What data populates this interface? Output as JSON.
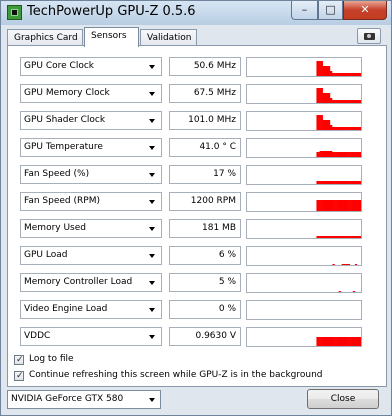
{
  "window": {
    "title": "TechPowerUp GPU-Z 0.5.6",
    "minimize_glyph": "–",
    "maximize_glyph": "□",
    "close_glyph": "✕"
  },
  "tabs": [
    {
      "label": "Graphics Card",
      "active": false
    },
    {
      "label": "Sensors",
      "active": true
    },
    {
      "label": "Validation",
      "active": false
    }
  ],
  "icons": {
    "screenshot": "camera-icon",
    "dropdown": "chevron-down-icon",
    "app": "gpu-z-icon"
  },
  "sensors": [
    {
      "label": "GPU Core Clock",
      "value": "50.6 MHz",
      "history": [
        0,
        0,
        0,
        0,
        0,
        0,
        0,
        0,
        0,
        0,
        0,
        0,
        0,
        0,
        0,
        0,
        0,
        0,
        0,
        0,
        0,
        0,
        0,
        0,
        0,
        0,
        0,
        0,
        0,
        0,
        0,
        0,
        0,
        0,
        0,
        0,
        0,
        0,
        0,
        0,
        0,
        0,
        0,
        0,
        0,
        0,
        0,
        0,
        0,
        0,
        0,
        0,
        0,
        0,
        0,
        0,
        0,
        0,
        0,
        0,
        0,
        0,
        0,
        0,
        0,
        0,
        0,
        0.85,
        0.85,
        0.85,
        0.85,
        0.85,
        0.85,
        0.55,
        0.55,
        0.55,
        0.55,
        0.55,
        0.55,
        0.55,
        0.25,
        0.25,
        0.15,
        0.15,
        0.15,
        0.15,
        0.15,
        0.15,
        0.15,
        0.15,
        0.15,
        0.15,
        0.15,
        0.15,
        0.15,
        0.15,
        0.15,
        0.15,
        0.15,
        0.15,
        0.15,
        0.15,
        0.15,
        0.15,
        0.15,
        0.15,
        0.15,
        0.15,
        0.15,
        0.15
      ]
    },
    {
      "label": "GPU Memory Clock",
      "value": "67.5 MHz",
      "history": [
        0,
        0,
        0,
        0,
        0,
        0,
        0,
        0,
        0,
        0,
        0,
        0,
        0,
        0,
        0,
        0,
        0,
        0,
        0,
        0,
        0,
        0,
        0,
        0,
        0,
        0,
        0,
        0,
        0,
        0,
        0,
        0,
        0,
        0,
        0,
        0,
        0,
        0,
        0,
        0,
        0,
        0,
        0,
        0,
        0,
        0,
        0,
        0,
        0,
        0,
        0,
        0,
        0,
        0,
        0,
        0,
        0,
        0,
        0,
        0,
        0,
        0,
        0,
        0,
        0,
        0,
        0,
        0.85,
        0.85,
        0.85,
        0.85,
        0.85,
        0.85,
        0.55,
        0.55,
        0.55,
        0.55,
        0.55,
        0.55,
        0.55,
        0.25,
        0.25,
        0.15,
        0.15,
        0.15,
        0.15,
        0.15,
        0.15,
        0.15,
        0.15,
        0.15,
        0.15,
        0.15,
        0.15,
        0.15,
        0.15,
        0.15,
        0.15,
        0.15,
        0.15,
        0.15,
        0.15,
        0.15,
        0.15,
        0.15,
        0.15,
        0.15,
        0.15,
        0.15,
        0.15
      ]
    },
    {
      "label": "GPU Shader Clock",
      "value": "101.0 MHz",
      "history": [
        0,
        0,
        0,
        0,
        0,
        0,
        0,
        0,
        0,
        0,
        0,
        0,
        0,
        0,
        0,
        0,
        0,
        0,
        0,
        0,
        0,
        0,
        0,
        0,
        0,
        0,
        0,
        0,
        0,
        0,
        0,
        0,
        0,
        0,
        0,
        0,
        0,
        0,
        0,
        0,
        0,
        0,
        0,
        0,
        0,
        0,
        0,
        0,
        0,
        0,
        0,
        0,
        0,
        0,
        0,
        0,
        0,
        0,
        0,
        0,
        0,
        0,
        0,
        0,
        0,
        0,
        0,
        0.85,
        0.85,
        0.85,
        0.85,
        0.85,
        0.85,
        0.55,
        0.55,
        0.55,
        0.55,
        0.55,
        0.55,
        0.55,
        0.25,
        0.25,
        0.15,
        0.15,
        0.15,
        0.15,
        0.15,
        0.15,
        0.15,
        0.15,
        0.15,
        0.15,
        0.15,
        0.15,
        0.15,
        0.15,
        0.15,
        0.15,
        0.15,
        0.15,
        0.15,
        0.15,
        0.15,
        0.15,
        0.15,
        0.15,
        0.15,
        0.15,
        0.15,
        0.15
      ]
    },
    {
      "label": "GPU Temperature",
      "value": "41.0 ° C",
      "history": [
        0,
        0,
        0,
        0,
        0,
        0,
        0,
        0,
        0,
        0,
        0,
        0,
        0,
        0,
        0,
        0,
        0,
        0,
        0,
        0,
        0,
        0,
        0,
        0,
        0,
        0,
        0,
        0,
        0,
        0,
        0,
        0,
        0,
        0,
        0,
        0,
        0,
        0,
        0,
        0,
        0,
        0,
        0,
        0,
        0,
        0,
        0,
        0,
        0,
        0,
        0,
        0,
        0,
        0,
        0,
        0,
        0,
        0,
        0,
        0,
        0,
        0,
        0,
        0,
        0,
        0,
        0,
        0.3,
        0.3,
        0.3,
        0.35,
        0.35,
        0.35,
        0.35,
        0.35,
        0.35,
        0.35,
        0.35,
        0.35,
        0.35,
        0.35,
        0.35,
        0.3,
        0.3,
        0.3,
        0.3,
        0.3,
        0.3,
        0.3,
        0.3,
        0.3,
        0.3,
        0.3,
        0.3,
        0.3,
        0.3,
        0.3,
        0.3,
        0.3,
        0.3,
        0.3,
        0.3,
        0.3,
        0.3,
        0.3,
        0.3,
        0.3,
        0.3,
        0.3,
        0.3
      ]
    },
    {
      "label": "Fan Speed (%)",
      "value": "17 %",
      "history": [
        0,
        0,
        0,
        0,
        0,
        0,
        0,
        0,
        0,
        0,
        0,
        0,
        0,
        0,
        0,
        0,
        0,
        0,
        0,
        0,
        0,
        0,
        0,
        0,
        0,
        0,
        0,
        0,
        0,
        0,
        0,
        0,
        0,
        0,
        0,
        0,
        0,
        0,
        0,
        0,
        0,
        0,
        0,
        0,
        0,
        0,
        0,
        0,
        0,
        0,
        0,
        0,
        0,
        0,
        0,
        0,
        0,
        0,
        0,
        0,
        0,
        0,
        0,
        0,
        0,
        0,
        0,
        0.17,
        0.17,
        0.17,
        0.17,
        0.17,
        0.17,
        0.17,
        0.17,
        0.17,
        0.17,
        0.17,
        0.17,
        0.17,
        0.17,
        0.17,
        0.17,
        0.17,
        0.17,
        0.17,
        0.17,
        0.17,
        0.17,
        0.17,
        0.17,
        0.17,
        0.17,
        0.17,
        0.17,
        0.17,
        0.17,
        0.17,
        0.17,
        0.17,
        0.17,
        0.17,
        0.17,
        0.17,
        0.17,
        0.17,
        0.17,
        0.17,
        0.17,
        0.17
      ]
    },
    {
      "label": "Fan Speed (RPM)",
      "value": "1200 RPM",
      "history": [
        0,
        0,
        0,
        0,
        0,
        0,
        0,
        0,
        0,
        0,
        0,
        0,
        0,
        0,
        0,
        0,
        0,
        0,
        0,
        0,
        0,
        0,
        0,
        0,
        0,
        0,
        0,
        0,
        0,
        0,
        0,
        0,
        0,
        0,
        0,
        0,
        0,
        0,
        0,
        0,
        0,
        0,
        0,
        0,
        0,
        0,
        0,
        0,
        0,
        0,
        0,
        0,
        0,
        0,
        0,
        0,
        0,
        0,
        0,
        0,
        0,
        0,
        0,
        0,
        0,
        0,
        0,
        0.6,
        0.6,
        0.6,
        0.6,
        0.6,
        0.6,
        0.6,
        0.6,
        0.6,
        0.6,
        0.6,
        0.6,
        0.6,
        0.6,
        0.6,
        0.6,
        0.6,
        0.6,
        0.6,
        0.6,
        0.6,
        0.6,
        0.6,
        0.6,
        0.6,
        0.6,
        0.6,
        0.6,
        0.6,
        0.6,
        0.6,
        0.6,
        0.6,
        0.6,
        0.6,
        0.6,
        0.6,
        0.6,
        0.6,
        0.6,
        0.6,
        0.6,
        0.6
      ]
    },
    {
      "label": "Memory Used",
      "value": "181 MB",
      "history": [
        0,
        0,
        0,
        0,
        0,
        0,
        0,
        0,
        0,
        0,
        0,
        0,
        0,
        0,
        0,
        0,
        0,
        0,
        0,
        0,
        0,
        0,
        0,
        0,
        0,
        0,
        0,
        0,
        0,
        0,
        0,
        0,
        0,
        0,
        0,
        0,
        0,
        0,
        0,
        0,
        0,
        0,
        0,
        0,
        0,
        0,
        0,
        0,
        0,
        0,
        0,
        0,
        0,
        0,
        0,
        0,
        0,
        0,
        0,
        0,
        0,
        0,
        0,
        0,
        0,
        0,
        0,
        0.12,
        0.12,
        0.12,
        0.12,
        0.12,
        0.12,
        0.12,
        0.12,
        0.12,
        0.12,
        0.12,
        0.12,
        0.12,
        0.12,
        0.12,
        0.12,
        0.12,
        0.12,
        0.12,
        0.12,
        0.12,
        0.12,
        0.12,
        0.12,
        0.12,
        0.12,
        0.12,
        0.12,
        0.12,
        0.12,
        0.12,
        0.12,
        0.12,
        0.12,
        0.12,
        0.12,
        0.12,
        0.12,
        0.12,
        0.12,
        0.12,
        0.12,
        0.12
      ]
    },
    {
      "label": "GPU Load",
      "value": "6 %",
      "history": [
        0,
        0,
        0,
        0,
        0,
        0,
        0,
        0,
        0,
        0,
        0,
        0,
        0,
        0,
        0,
        0,
        0,
        0,
        0,
        0,
        0,
        0,
        0,
        0,
        0,
        0,
        0,
        0,
        0,
        0,
        0,
        0,
        0,
        0,
        0,
        0,
        0,
        0,
        0,
        0,
        0,
        0,
        0,
        0,
        0,
        0,
        0,
        0,
        0,
        0,
        0,
        0,
        0,
        0,
        0,
        0,
        0,
        0,
        0,
        0,
        0,
        0,
        0,
        0,
        0,
        0,
        0,
        0,
        0,
        0,
        0,
        0,
        0,
        0,
        0,
        0,
        0,
        0,
        0,
        0,
        0,
        0,
        0,
        0,
        0.06,
        0.06,
        0,
        0,
        0,
        0,
        0,
        0,
        0,
        0.06,
        0.06,
        0.06,
        0.06,
        0.06,
        0.06,
        0.06,
        0.06,
        0,
        0,
        0,
        0,
        0,
        0.06,
        0.06,
        0,
        0,
        0,
        0
      ]
    },
    {
      "label": "Memory Controller Load",
      "value": "5 %",
      "history": [
        0,
        0,
        0,
        0,
        0,
        0,
        0,
        0,
        0,
        0,
        0,
        0,
        0,
        0,
        0,
        0,
        0,
        0,
        0,
        0,
        0,
        0,
        0,
        0,
        0,
        0,
        0,
        0,
        0,
        0,
        0,
        0,
        0,
        0,
        0,
        0,
        0,
        0,
        0,
        0,
        0,
        0,
        0,
        0,
        0,
        0,
        0,
        0,
        0,
        0,
        0,
        0,
        0,
        0,
        0,
        0,
        0,
        0,
        0,
        0,
        0,
        0,
        0,
        0,
        0,
        0,
        0,
        0,
        0,
        0,
        0,
        0,
        0,
        0,
        0,
        0,
        0,
        0,
        0,
        0,
        0,
        0,
        0,
        0,
        0,
        0,
        0,
        0,
        0,
        0,
        0.05,
        0.05,
        0,
        0,
        0,
        0,
        0,
        0,
        0,
        0,
        0,
        0,
        0,
        0,
        0.05,
        0.05,
        0,
        0,
        0,
        0,
        0,
        0
      ]
    },
    {
      "label": "Video Engine Load",
      "value": "0 %",
      "history": []
    },
    {
      "label": "VDDC",
      "value": "0.9630 V",
      "history": [
        0,
        0,
        0,
        0,
        0,
        0,
        0,
        0,
        0,
        0,
        0,
        0,
        0,
        0,
        0,
        0,
        0,
        0,
        0,
        0,
        0,
        0,
        0,
        0,
        0,
        0,
        0,
        0,
        0,
        0,
        0,
        0,
        0,
        0,
        0,
        0,
        0,
        0,
        0,
        0,
        0,
        0,
        0,
        0,
        0,
        0,
        0,
        0,
        0,
        0,
        0,
        0,
        0,
        0,
        0,
        0,
        0,
        0,
        0,
        0,
        0,
        0,
        0,
        0,
        0,
        0,
        0,
        0.5,
        0.5,
        0.5,
        0.5,
        0.5,
        0.5,
        0.5,
        0.5,
        0.5,
        0.5,
        0.5,
        0.5,
        0.5,
        0.5,
        0.5,
        0.5,
        0.5,
        0.5,
        0.5,
        0.5,
        0.5,
        0.5,
        0.5,
        0.5,
        0.5,
        0.5,
        0.5,
        0.5,
        0.5,
        0.5,
        0.5,
        0.5,
        0.5,
        0.5,
        0.5,
        0.5,
        0.5,
        0.5,
        0.5,
        0.5,
        0.5,
        0.5,
        0.5
      ]
    }
  ],
  "options": {
    "log_to_file": {
      "label": "Log to file",
      "checked": true
    },
    "continue_refreshing": {
      "label": "Continue refreshing this screen while GPU-Z is in the background",
      "checked": true
    }
  },
  "footer": {
    "gpu_select": "NVIDIA GeForce GTX 580",
    "close_label": "Close"
  },
  "colors": {
    "graph": "#ff0000",
    "check": "#223344"
  }
}
